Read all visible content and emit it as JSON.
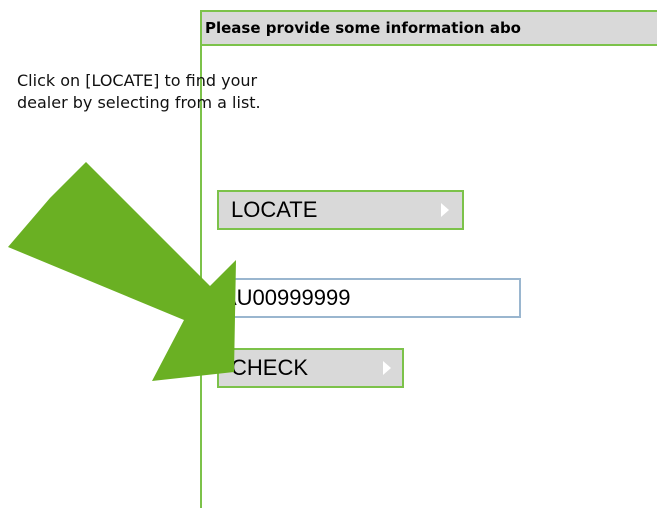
{
  "panel": {
    "header": "Please provide some information abo",
    "instructions": [
      "Click on [LOCATE] to find your",
      "dealer by selecting from a list."
    ]
  },
  "locate_button": {
    "label": "LOCATE",
    "icon": "triangle-right-icon"
  },
  "dealer_field": {
    "value": "AU00999999"
  },
  "check_button": {
    "label": "CHECK",
    "icon": "triangle-right-icon"
  },
  "annotation": {
    "icon": "pointer-arrow-icon",
    "color": "#6ab023"
  },
  "colors": {
    "border_accent": "#7cc24a",
    "button_bg": "#d9d9d9",
    "input_border": "#9ab6cf"
  }
}
